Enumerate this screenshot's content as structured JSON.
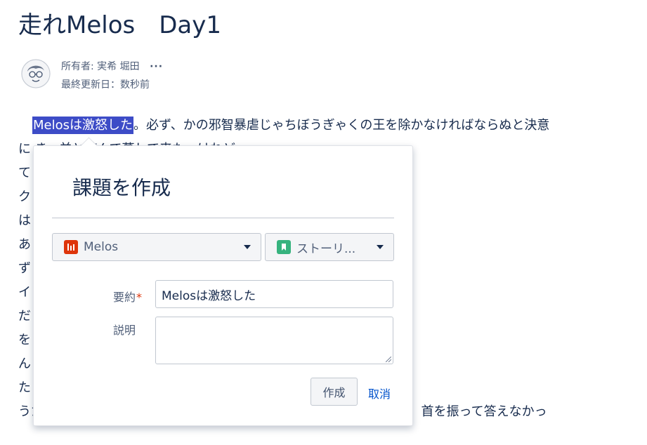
{
  "page": {
    "title": "走れMelos　Day1",
    "owner": "所有者: 実希 堀田",
    "more_label": "···",
    "last_updated": "最終更新日：数秒前"
  },
  "body": {
    "highlight": "Melosは激怒した",
    "lines": [
      "。必ず、かの邪智暴虐じゃちぼうぎゃくの王を除かなければならぬと決意",
      "に                                                                 き、羊と遊んで暮して来た。けれど",
      "て                                                                 発し、野を越え山越え、十里はなれ",
      "ク                                                                 も無い。十六の、内気な妹と二人暮",
      "は                                                                 迎える事になっていた。結婚式も間",
      "あ                                                                 やらを買いに、はるばる市にやって",
      "ず                                                                 いた。Melosには竹馬の友があった",
      "イ                                                                 。その友を、これから訪ねてみるつ",
      "だ                                                                 である。歩いているうちにMelosは",
      "を                                                                 、まちの暗いのは当りまえだが、け",
      "ん                                                                 い。のんきなMelosも、だんだん不",
      "た                                                                 年まえに此の市に来たときは、夜で",
      "うたって、まちは賑やかであった筈はずだが、と質問した。若い衆は、首を振って答えなかっ"
    ]
  },
  "dialog": {
    "title": "課題を作成",
    "project": {
      "label": "Melos"
    },
    "issue_type": {
      "label": "ストーリ..."
    },
    "summary": {
      "label": "要約",
      "required_mark": "*",
      "value": "Melosは激怒した"
    },
    "description": {
      "label": "説明",
      "value": ""
    },
    "create_button": "作成",
    "cancel_link": "取消"
  }
}
